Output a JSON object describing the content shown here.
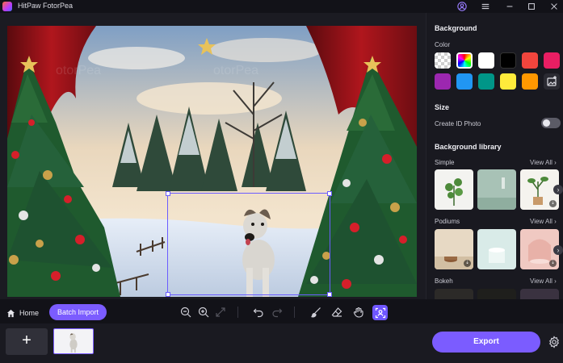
{
  "app": {
    "title": "HitPaw FotorPea"
  },
  "panel": {
    "background_title": "Background",
    "color_label": "Color",
    "swatches": [
      "transparent",
      "rainbow",
      "#ffffff",
      "#000000",
      "#f1453d",
      "#e91e63",
      "#9c27b0",
      "#2196f3",
      "#009688",
      "#ffeb3b",
      "#ff9800",
      "add-image"
    ],
    "size_title": "Size",
    "id_photo_label": "Create ID Photo",
    "library_title": "Background library",
    "simple_label": "Simple",
    "podiums_label": "Podiums",
    "bokeh_label": "Bokeh",
    "view_all": "View All"
  },
  "toolbar": {
    "home_label": "Home",
    "batch_label": "Batch Import"
  },
  "footer": {
    "add_label": "+",
    "export_label": "Export"
  },
  "colors": {
    "accent": "#7b5cff",
    "background": "#121218",
    "panel": "#191920"
  }
}
